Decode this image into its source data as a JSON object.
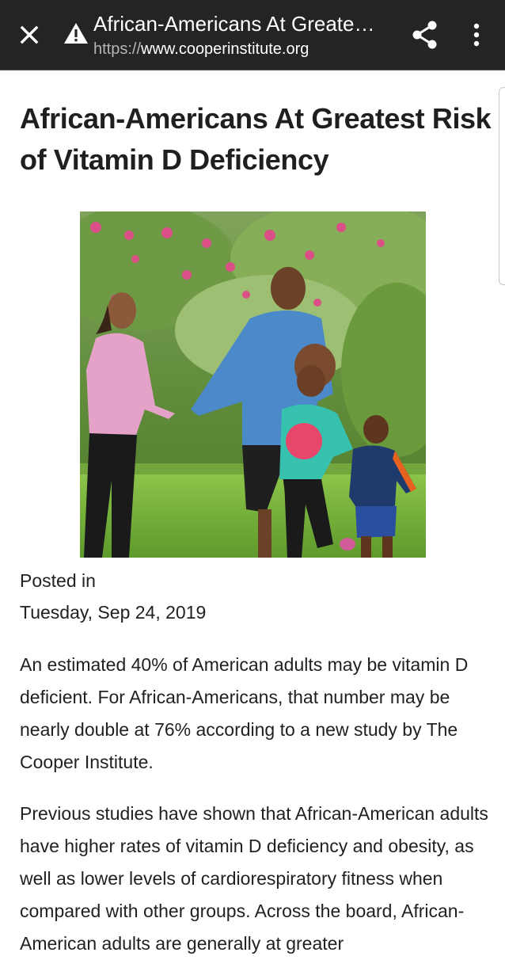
{
  "toolbar": {
    "title": "African-Americans At Greate…",
    "url_scheme": "https://",
    "url_host": "www.cooperinstitute.org",
    "icons": [
      "close-icon",
      "warning-icon",
      "share-icon",
      "more-vert-icon"
    ]
  },
  "article": {
    "title": "African-Americans At Greatest Risk of Vitamin D Deficiency",
    "posted_label": "Posted in",
    "date": "Tuesday, Sep 24, 2019",
    "paragraphs": [
      "An estimated 40% of American adults may be vitamin D deficient. For African-Americans, that number may be nearly double at 76% according to a new study by The Cooper Institute.",
      "Previous studies have shown that African-American adults have higher rates of vitamin D deficiency and obesity, as well as lower levels of cardiorespiratory fitness when compared with other groups. Across the board, African-American adults are generally at greater"
    ]
  },
  "colors": {
    "toolbar_bg": "#242424",
    "toolbar_text": "#ffffff",
    "url_scheme": "#b6b6b6",
    "body_text": "#202124"
  }
}
